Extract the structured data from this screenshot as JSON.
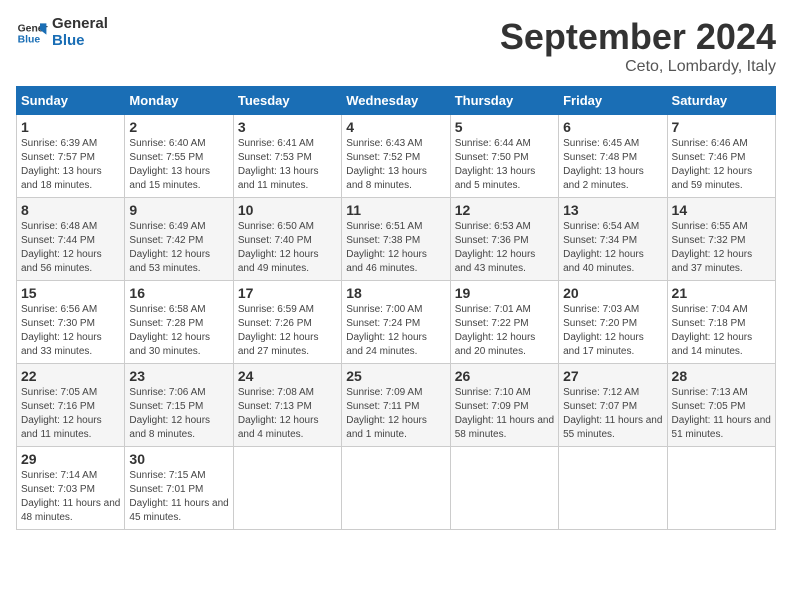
{
  "header": {
    "logo_text_general": "General",
    "logo_text_blue": "Blue",
    "month": "September 2024",
    "location": "Ceto, Lombardy, Italy"
  },
  "columns": [
    "Sunday",
    "Monday",
    "Tuesday",
    "Wednesday",
    "Thursday",
    "Friday",
    "Saturday"
  ],
  "weeks": [
    [
      {
        "day": "1",
        "sunrise": "6:39 AM",
        "sunset": "7:57 PM",
        "daylight": "13 hours and 18 minutes."
      },
      {
        "day": "2",
        "sunrise": "6:40 AM",
        "sunset": "7:55 PM",
        "daylight": "13 hours and 15 minutes."
      },
      {
        "day": "3",
        "sunrise": "6:41 AM",
        "sunset": "7:53 PM",
        "daylight": "13 hours and 11 minutes."
      },
      {
        "day": "4",
        "sunrise": "6:43 AM",
        "sunset": "7:52 PM",
        "daylight": "13 hours and 8 minutes."
      },
      {
        "day": "5",
        "sunrise": "6:44 AM",
        "sunset": "7:50 PM",
        "daylight": "13 hours and 5 minutes."
      },
      {
        "day": "6",
        "sunrise": "6:45 AM",
        "sunset": "7:48 PM",
        "daylight": "13 hours and 2 minutes."
      },
      {
        "day": "7",
        "sunrise": "6:46 AM",
        "sunset": "7:46 PM",
        "daylight": "12 hours and 59 minutes."
      }
    ],
    [
      {
        "day": "8",
        "sunrise": "6:48 AM",
        "sunset": "7:44 PM",
        "daylight": "12 hours and 56 minutes."
      },
      {
        "day": "9",
        "sunrise": "6:49 AM",
        "sunset": "7:42 PM",
        "daylight": "12 hours and 53 minutes."
      },
      {
        "day": "10",
        "sunrise": "6:50 AM",
        "sunset": "7:40 PM",
        "daylight": "12 hours and 49 minutes."
      },
      {
        "day": "11",
        "sunrise": "6:51 AM",
        "sunset": "7:38 PM",
        "daylight": "12 hours and 46 minutes."
      },
      {
        "day": "12",
        "sunrise": "6:53 AM",
        "sunset": "7:36 PM",
        "daylight": "12 hours and 43 minutes."
      },
      {
        "day": "13",
        "sunrise": "6:54 AM",
        "sunset": "7:34 PM",
        "daylight": "12 hours and 40 minutes."
      },
      {
        "day": "14",
        "sunrise": "6:55 AM",
        "sunset": "7:32 PM",
        "daylight": "12 hours and 37 minutes."
      }
    ],
    [
      {
        "day": "15",
        "sunrise": "6:56 AM",
        "sunset": "7:30 PM",
        "daylight": "12 hours and 33 minutes."
      },
      {
        "day": "16",
        "sunrise": "6:58 AM",
        "sunset": "7:28 PM",
        "daylight": "12 hours and 30 minutes."
      },
      {
        "day": "17",
        "sunrise": "6:59 AM",
        "sunset": "7:26 PM",
        "daylight": "12 hours and 27 minutes."
      },
      {
        "day": "18",
        "sunrise": "7:00 AM",
        "sunset": "7:24 PM",
        "daylight": "12 hours and 24 minutes."
      },
      {
        "day": "19",
        "sunrise": "7:01 AM",
        "sunset": "7:22 PM",
        "daylight": "12 hours and 20 minutes."
      },
      {
        "day": "20",
        "sunrise": "7:03 AM",
        "sunset": "7:20 PM",
        "daylight": "12 hours and 17 minutes."
      },
      {
        "day": "21",
        "sunrise": "7:04 AM",
        "sunset": "7:18 PM",
        "daylight": "12 hours and 14 minutes."
      }
    ],
    [
      {
        "day": "22",
        "sunrise": "7:05 AM",
        "sunset": "7:16 PM",
        "daylight": "12 hours and 11 minutes."
      },
      {
        "day": "23",
        "sunrise": "7:06 AM",
        "sunset": "7:15 PM",
        "daylight": "12 hours and 8 minutes."
      },
      {
        "day": "24",
        "sunrise": "7:08 AM",
        "sunset": "7:13 PM",
        "daylight": "12 hours and 4 minutes."
      },
      {
        "day": "25",
        "sunrise": "7:09 AM",
        "sunset": "7:11 PM",
        "daylight": "12 hours and 1 minute."
      },
      {
        "day": "26",
        "sunrise": "7:10 AM",
        "sunset": "7:09 PM",
        "daylight": "11 hours and 58 minutes."
      },
      {
        "day": "27",
        "sunrise": "7:12 AM",
        "sunset": "7:07 PM",
        "daylight": "11 hours and 55 minutes."
      },
      {
        "day": "28",
        "sunrise": "7:13 AM",
        "sunset": "7:05 PM",
        "daylight": "11 hours and 51 minutes."
      }
    ],
    [
      {
        "day": "29",
        "sunrise": "7:14 AM",
        "sunset": "7:03 PM",
        "daylight": "11 hours and 48 minutes."
      },
      {
        "day": "30",
        "sunrise": "7:15 AM",
        "sunset": "7:01 PM",
        "daylight": "11 hours and 45 minutes."
      },
      null,
      null,
      null,
      null,
      null
    ]
  ]
}
